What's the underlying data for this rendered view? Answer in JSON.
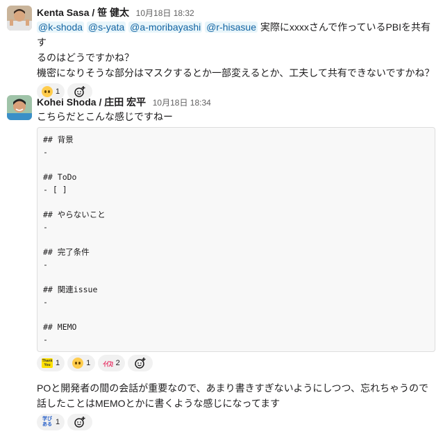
{
  "messages": [
    {
      "author": "Kenta Sasa / 笹 健太",
      "time": "10月18日 18:32",
      "mentions": [
        "@k-shoda",
        "@s-yata",
        "@a-moribayashi",
        "@r-hisasue"
      ],
      "text_after_mentions": "実際にxxxxさんで作っているPBIを共有す",
      "line2": "るのはどうですかね？",
      "line3": "機密になりそうな部分はマスクするとか一部変えるとか、工夫して共有できないですかね？",
      "reactions": [
        {
          "emoji": "pleading-face",
          "count": "1"
        }
      ]
    },
    {
      "author": "Kohei Shoda / 庄田 宏平",
      "time": "10月18日 18:34",
      "text": "こちらだとこんな感じですねー",
      "code_lines": [
        "## 背景",
        "-",
        "",
        "## ToDo",
        "- [ ]",
        "",
        "## やらないこと",
        "-",
        "",
        "## 完了条件",
        "-",
        "",
        "## 関連issue",
        "-",
        "",
        "## MEMO",
        "-"
      ],
      "reactions": [
        {
          "emoji": "thank-you",
          "label": "Thank You",
          "count": "1"
        },
        {
          "emoji": "pleading-face",
          "count": "1"
        },
        {
          "emoji": "ikisu",
          "label": "ｲｲｽ!",
          "count": "2"
        }
      ]
    },
    {
      "text_line1": "POと開発者の間の会話が重要なので、あまり書きすぎないようにしつつ、忘れちゃうので",
      "text_line2": "話したことはMEMOとかに書くような感じになってます",
      "reactions": [
        {
          "emoji": "manabi-aru",
          "label": "学びある",
          "count": "1"
        }
      ]
    }
  ],
  "colors": {
    "mention_bg": "#e8f5fa",
    "mention_text": "#1264a3",
    "reaction_bg": "#f1f1f1"
  }
}
